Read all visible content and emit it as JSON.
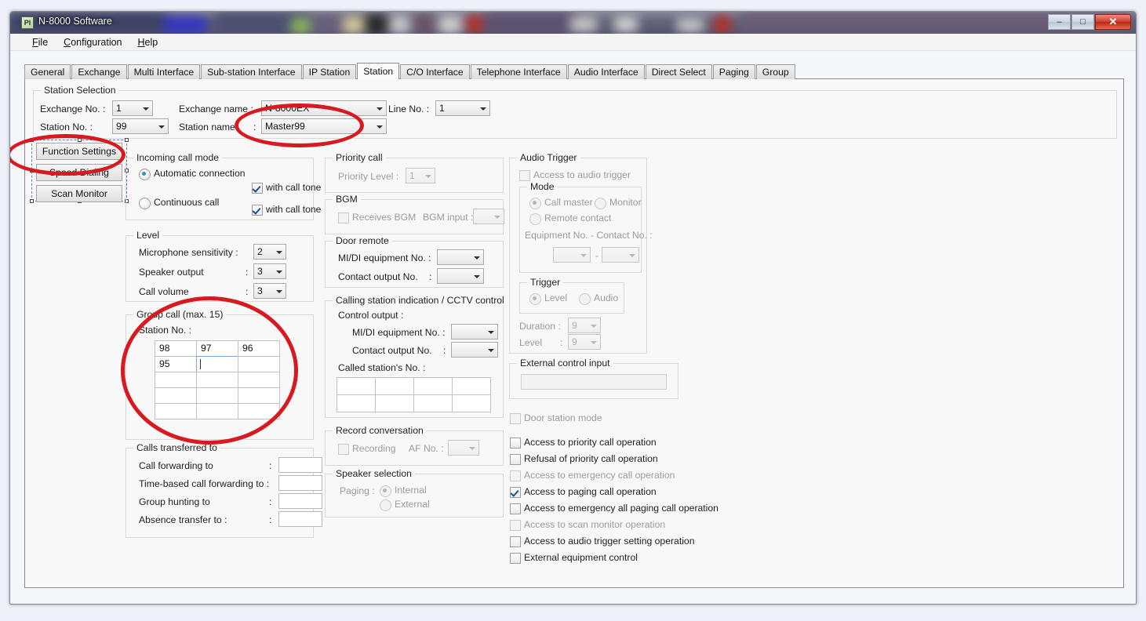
{
  "window": {
    "title": "N-8000 Software",
    "app_icon": "PI",
    "buttons": {
      "minimize": "–",
      "maximize": "□",
      "close": "✕"
    }
  },
  "menubar": [
    {
      "label": "File",
      "accel": "F"
    },
    {
      "label": "Configuration",
      "accel": "C"
    },
    {
      "label": "Help",
      "accel": "H"
    }
  ],
  "tabs": [
    {
      "label": "General",
      "active": false
    },
    {
      "label": "Exchange",
      "active": false
    },
    {
      "label": "Multi Interface",
      "active": false
    },
    {
      "label": "Sub-station Interface",
      "active": false
    },
    {
      "label": "IP Station",
      "active": false
    },
    {
      "label": "Station",
      "active": true
    },
    {
      "label": "C/O Interface",
      "active": false
    },
    {
      "label": "Telephone Interface",
      "active": false
    },
    {
      "label": "Audio Interface",
      "active": false
    },
    {
      "label": "Direct Select",
      "active": false
    },
    {
      "label": "Paging",
      "active": false
    },
    {
      "label": "Group",
      "active": false
    }
  ],
  "station_selection": {
    "caption": "Station Selection",
    "exchange_no_label": "Exchange No. :",
    "exchange_no_value": "1",
    "station_no_label": "Station No.     :",
    "station_no_value": "99",
    "exchange_name_label": "Exchange name :",
    "exchange_name_value": "N-8000EX",
    "station_name_label": "Station name",
    "station_name_colon": ":",
    "station_name_value": "Master99",
    "line_no_label": "Line No. :",
    "line_no_value": "1"
  },
  "side_buttons": [
    {
      "label": "Function Settings"
    },
    {
      "label": "Speed Dialing"
    },
    {
      "label": "Scan Monitor"
    }
  ],
  "incoming_call_mode": {
    "caption": "Incoming call mode",
    "automatic": {
      "label": "Automatic connection",
      "selected": true
    },
    "automatic_tone": {
      "label": "with call tone",
      "checked": true
    },
    "continuous": {
      "label": "Continuous call",
      "selected": false
    },
    "continuous_tone": {
      "label": "with call tone",
      "checked": true
    }
  },
  "level": {
    "caption": "Level",
    "rows": [
      {
        "label": "Microphone sensitivity :",
        "value": "2"
      },
      {
        "label": "Speaker output",
        "colon": ":",
        "value": "3"
      },
      {
        "label": "Call volume",
        "colon": ":",
        "value": "3"
      }
    ]
  },
  "group_call": {
    "caption": "Group call (max. 15)",
    "station_no_label": "Station No. :",
    "values": [
      "98",
      "97",
      "96",
      "95",
      "",
      "",
      "",
      "",
      "",
      "",
      "",
      "",
      "",
      "",
      ""
    ],
    "focused_index": 4
  },
  "calls_transferred": {
    "caption": "Calls transferred to",
    "rows": [
      {
        "label": "Call forwarding to",
        "colon": ":",
        "value": ""
      },
      {
        "label": "Time-based call forwarding to :",
        "colon": "",
        "value": ""
      },
      {
        "label": "Group hunting to",
        "colon": ":",
        "value": ""
      },
      {
        "label": "Absence transfer to :",
        "colon": ":",
        "value": ""
      }
    ]
  },
  "priority_call": {
    "caption": "Priority call",
    "level_label": "Priority Level :",
    "level_value": "1",
    "disabled": true
  },
  "bgm": {
    "caption": "BGM",
    "receives_label": "Receives BGM",
    "receives_checked": false,
    "input_label": "BGM input :",
    "input_value": "",
    "disabled": true
  },
  "door_remote": {
    "caption": "Door remote",
    "rows": [
      {
        "label": "MI/DI equipment No. :",
        "value": ""
      },
      {
        "label": "Contact output No.",
        "colon": ":",
        "value": ""
      }
    ]
  },
  "cctv": {
    "caption": "Calling station indication / CCTV control",
    "control_output_label": "Control output :",
    "rows": [
      {
        "label": "MI/DI equipment No. :",
        "value": ""
      },
      {
        "label": "Contact output No.",
        "colon": ":",
        "value": ""
      }
    ],
    "called_station_label": "Called station's No. :",
    "called_station_values": [
      "",
      "",
      "",
      "",
      "",
      "",
      "",
      ""
    ]
  },
  "record_conversation": {
    "caption": "Record conversation",
    "recording_label": "Recording",
    "recording_checked": false,
    "af_label": "AF No. :",
    "af_value": "",
    "disabled": true
  },
  "speaker_selection": {
    "caption": "Speaker selection",
    "paging_label": "Paging :",
    "internal": {
      "label": "Internal",
      "selected": true
    },
    "external": {
      "label": "External",
      "selected": false
    },
    "disabled": true
  },
  "audio_trigger": {
    "caption": "Audio Trigger",
    "access_label": "Access to audio trigger",
    "access_checked": false,
    "mode": {
      "caption": "Mode",
      "call_master": {
        "label": "Call master",
        "selected": true
      },
      "monitor": {
        "label": "Monitor",
        "selected": false
      },
      "remote_contact": {
        "label": "Remote contact",
        "selected": false
      },
      "equipment_label": "Equipment No. - Contact No. :",
      "equipment_value": "",
      "dash": "-",
      "contact_value": ""
    },
    "trigger": {
      "caption": "Trigger",
      "level": {
        "label": "Level",
        "selected": true
      },
      "audio": {
        "label": "Audio",
        "selected": false
      }
    },
    "duration_label": "Duration :",
    "duration_value": "9",
    "level_label": "Level",
    "level_colon": ":",
    "level_value": "9"
  },
  "external_control_input": {
    "caption": "External control input",
    "value": ""
  },
  "option_checks": [
    {
      "label": "Door station mode",
      "checked": false,
      "disabled": true
    },
    {
      "label": "Access to priority call operation",
      "checked": false,
      "disabled": false
    },
    {
      "label": "Refusal of priority call operation",
      "checked": false,
      "disabled": false
    },
    {
      "label": "Access to emergency call operation",
      "checked": false,
      "disabled": true
    },
    {
      "label": "Access to paging call operation",
      "checked": true,
      "disabled": false
    },
    {
      "label": "Access to emergency all paging call operation",
      "checked": false,
      "disabled": false
    },
    {
      "label": "Access to scan monitor operation",
      "checked": false,
      "disabled": true
    },
    {
      "label": "Access to audio trigger setting operation",
      "checked": false,
      "disabled": false
    },
    {
      "label": "External equipment control",
      "checked": false,
      "disabled": false
    }
  ],
  "annotations": {
    "color": "#d71920",
    "shapes": [
      {
        "name": "station-name-highlight"
      },
      {
        "name": "function-settings-highlight"
      },
      {
        "name": "group-call-highlight"
      }
    ]
  }
}
